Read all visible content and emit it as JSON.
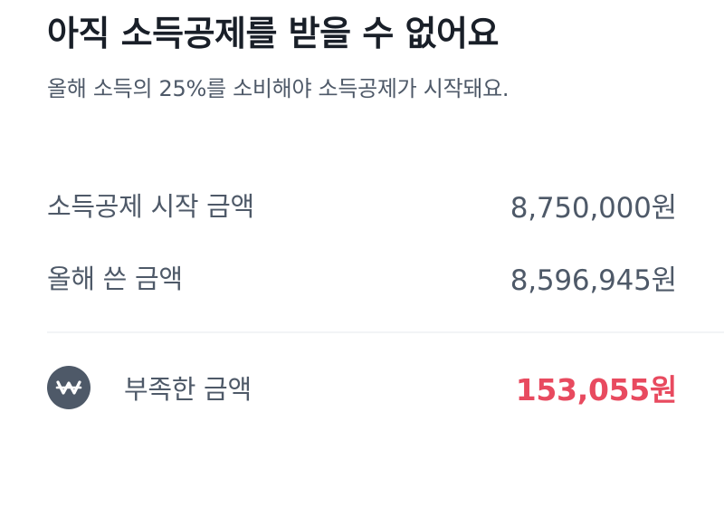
{
  "header": {
    "title": "아직 소득공제를 받을 수 없어요",
    "subtitle": "올해 소득의 25%를 소비해야 소득공제가 시작돼요."
  },
  "summary": {
    "rows": [
      {
        "label": "소득공제 시작 금액",
        "value": "8,750,000원"
      },
      {
        "label": "올해 쓴 금액",
        "value": "8,596,945원"
      }
    ],
    "shortfall": {
      "icon": "won-icon",
      "label": "부족한 금액",
      "value": "153,055원",
      "value_color": "#e84a5f"
    }
  }
}
